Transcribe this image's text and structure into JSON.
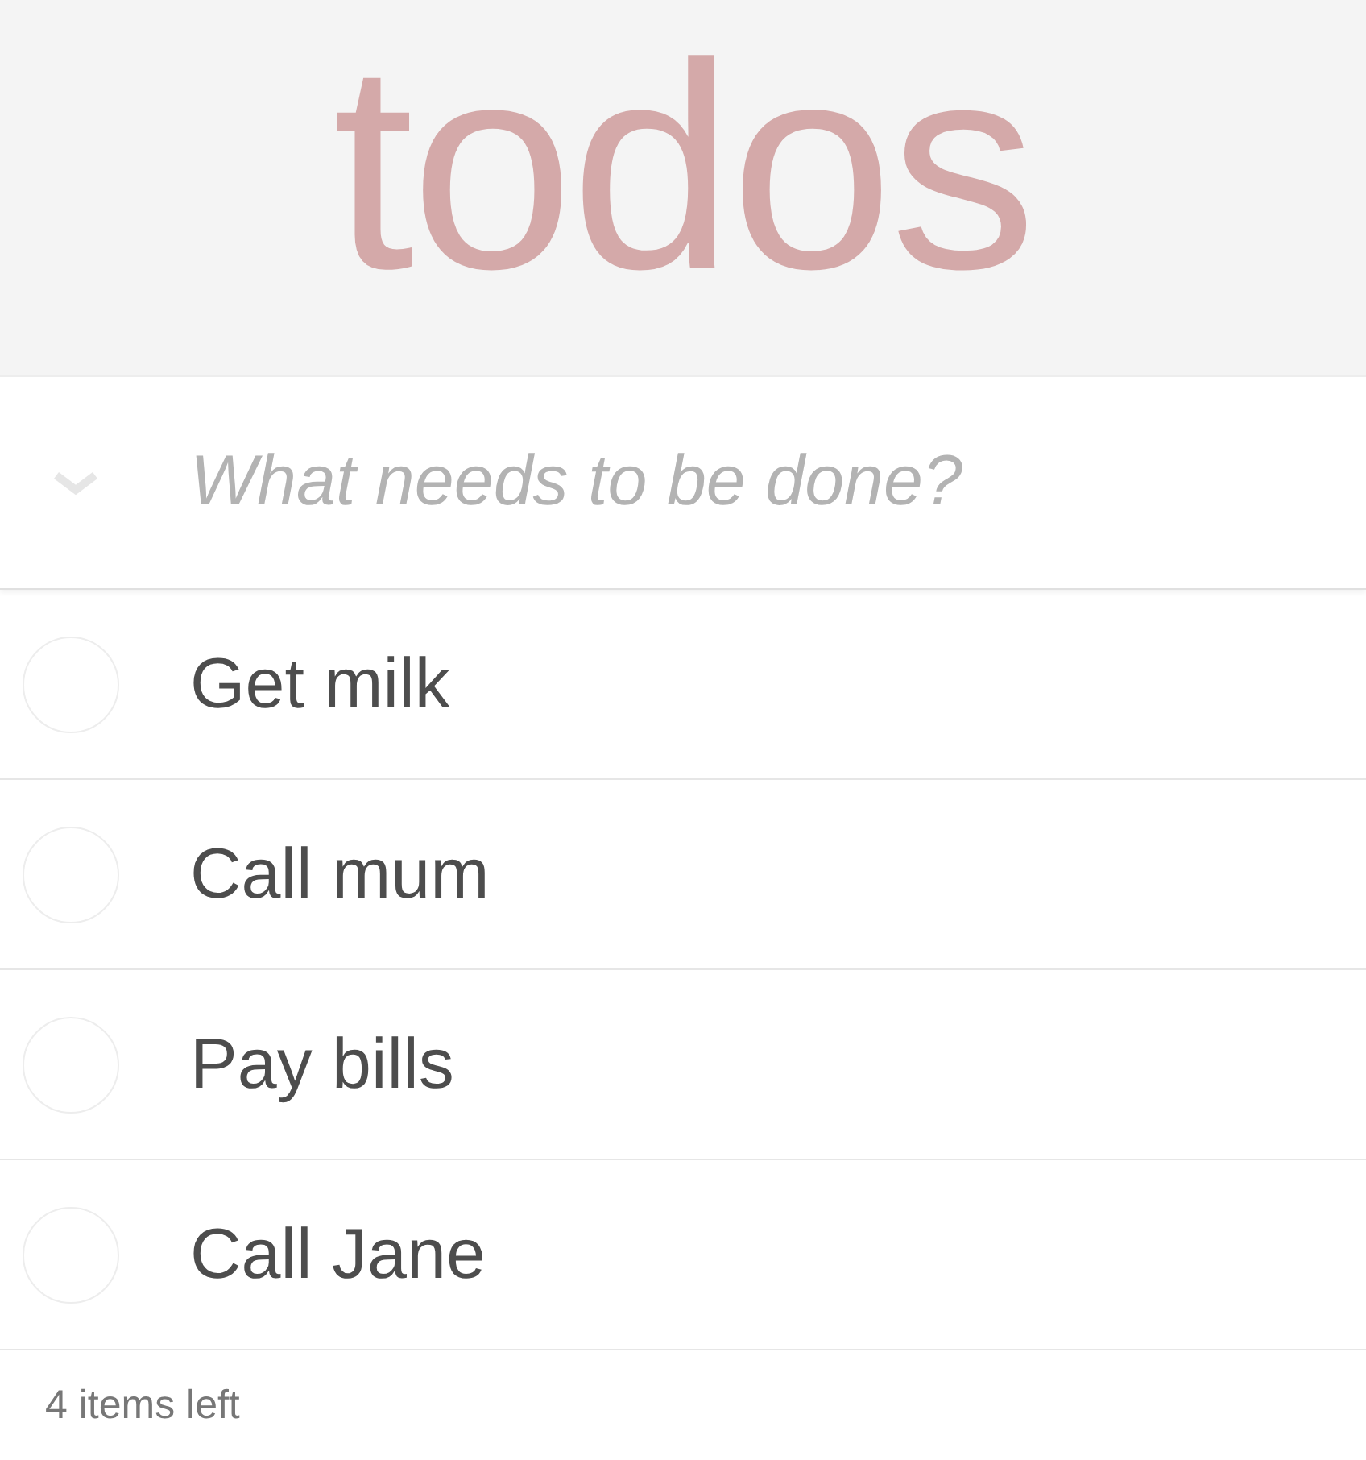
{
  "title": "todos",
  "new_todo": {
    "placeholder": "What needs to be done?"
  },
  "todos": [
    {
      "label": "Get milk",
      "completed": false
    },
    {
      "label": "Call mum",
      "completed": false
    },
    {
      "label": "Pay bills",
      "completed": false
    },
    {
      "label": "Call Jane",
      "completed": false
    }
  ],
  "footer": {
    "count": "4 items left"
  }
}
